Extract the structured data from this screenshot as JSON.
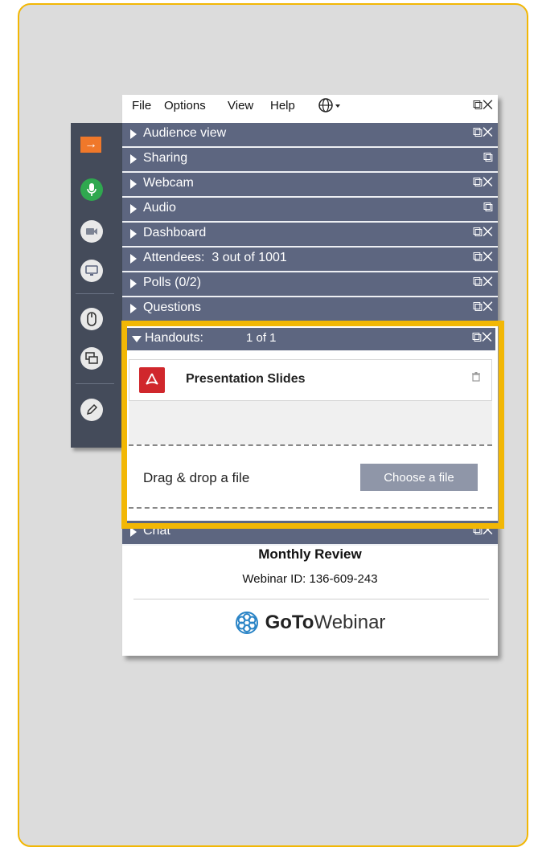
{
  "menu": {
    "items": [
      "File",
      "Options",
      "View",
      "Help"
    ],
    "globe_icon": "globe-icon",
    "restore_icon": "restore-icon",
    "close_icon": "close-icon"
  },
  "panels": [
    {
      "label": "Audience view",
      "has_close": true
    },
    {
      "label": "Sharing",
      "has_close": false
    },
    {
      "label": "Webcam",
      "has_close": true
    },
    {
      "label": "Audio",
      "has_close": false
    },
    {
      "label": "Dashboard",
      "has_close": true
    },
    {
      "label": "Attendees:  3 out of 1001",
      "has_close": true
    },
    {
      "label": "Polls (0/2)",
      "has_close": true
    },
    {
      "label": "Questions",
      "has_close": true
    }
  ],
  "handouts": {
    "label": "Handouts:",
    "count": "1 of 1",
    "file_name": "Presentation Slides",
    "drop_text": "Drag & drop a file",
    "choose_button": "Choose a file"
  },
  "chat": {
    "label": "Chat"
  },
  "webinar": {
    "title": "Monthly Review",
    "id_text": "Webinar ID: 136-609-243",
    "brand_bold": "GoTo",
    "brand_rest": "Webinar"
  },
  "colors": {
    "accent": "#f2b705",
    "panel_bar": "#5d6680",
    "toolbar": "#444b5a",
    "mic_green": "#2fa84f",
    "pdf_red": "#d0272c",
    "arrow_orange": "#f0782a"
  }
}
